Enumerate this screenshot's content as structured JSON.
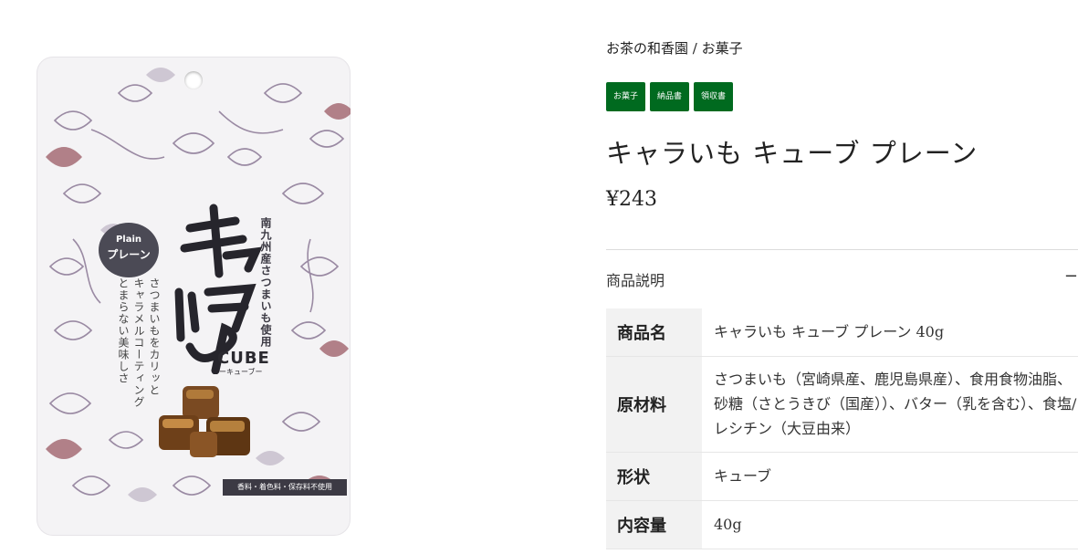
{
  "breadcrumb": "お茶の和香園 / お菓子",
  "tags": [
    "お菓子",
    "納品書",
    "領収書"
  ],
  "product": {
    "title": "キャラいも キューブ プレーン",
    "price": "¥243"
  },
  "package": {
    "plain_en": "Plain",
    "plain_ja": "プレーン",
    "sub_copy": "南九州産さつまいも使用",
    "desc_line1": "さつまいもをカリッと",
    "desc_line2": "キャラメルコーティング",
    "desc_line3": "とまらない美味しさ",
    "cube": "CUBE",
    "cube_kana": "ーキューブー",
    "no_additive": "香料・着色料・保存料不使用"
  },
  "accordion": {
    "label": "商品説明",
    "toggle_icon": "minus-icon",
    "toggle": "−"
  },
  "spec_rows": [
    {
      "label": "商品名",
      "value": "キャラいも キューブ プレーン 40g"
    },
    {
      "label": "原材料",
      "value": "さつまいも（宮崎県産、鹿児島県産）、食用食物油脂、砂糖（さとうきび（国産））、バター（乳を含む）、食塩/レシチン（大豆由来）"
    },
    {
      "label": "形状",
      "value": "キューブ"
    },
    {
      "label": "内容量",
      "value": "40g"
    }
  ],
  "colors": {
    "tag_bg": "#006a1f",
    "table_header_bg": "#f2f2f2",
    "pattern_leaf_purple": "#9a8aa3",
    "pattern_leaf_red": "#a56b74"
  }
}
